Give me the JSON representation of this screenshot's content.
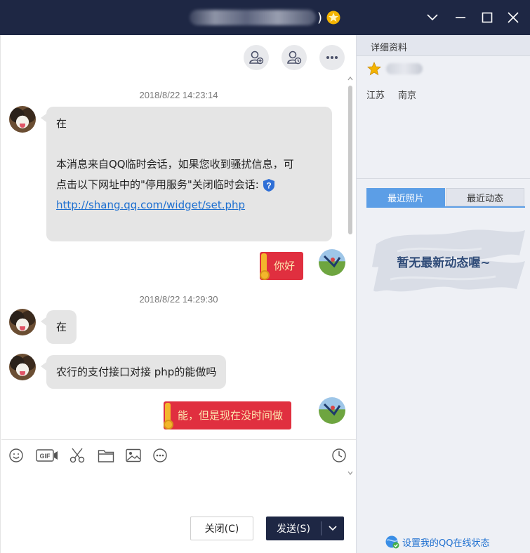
{
  "window": {
    "title_suffix": ")",
    "controls": [
      "collapse",
      "minimize",
      "maximize",
      "close"
    ]
  },
  "header_actions": [
    "add-friend-icon",
    "member-icon",
    "more-icon"
  ],
  "messages": [
    {
      "timestamp": "2018/8/22 14:23:14"
    },
    {
      "from": "other",
      "lines": [
        "在",
        "",
        "本消息来自QQ临时会话，如果您收到骚扰信息，可",
        "点击以下网址中的\"停用服务\"关闭临时会话:"
      ],
      "link": "http://shang.qq.com/widget/set.php"
    },
    {
      "from": "me",
      "text": "你好"
    },
    {
      "timestamp": "2018/8/22 14:29:30"
    },
    {
      "from": "other",
      "text": "在"
    },
    {
      "from": "other",
      "text": "农行的支付接口对接 php的能做吗"
    },
    {
      "from": "me",
      "text": "能，但是现在没时间做"
    }
  ],
  "toolbar": {
    "tools": [
      "emoji-icon",
      "gif-icon",
      "scissors-icon",
      "folder-icon",
      "image-icon",
      "more-circle-icon"
    ],
    "history": "clock-icon"
  },
  "buttons": {
    "close_label": "关闭(C)",
    "send_label": "发送(S)"
  },
  "side": {
    "header": "详细资料",
    "province": "江苏",
    "city": "南京",
    "tab_photos": "最近照片",
    "tab_updates": "最近动态",
    "empty_text": "暂无最新动态喔~",
    "status_link": "设置我的QQ在线状态"
  },
  "colors": {
    "titlebar": "#1e2744",
    "bubble_other": "#e5e5e5",
    "bubble_me": "#e02f3f",
    "accent": "#5c9ee6",
    "link": "#1d6fd0"
  }
}
